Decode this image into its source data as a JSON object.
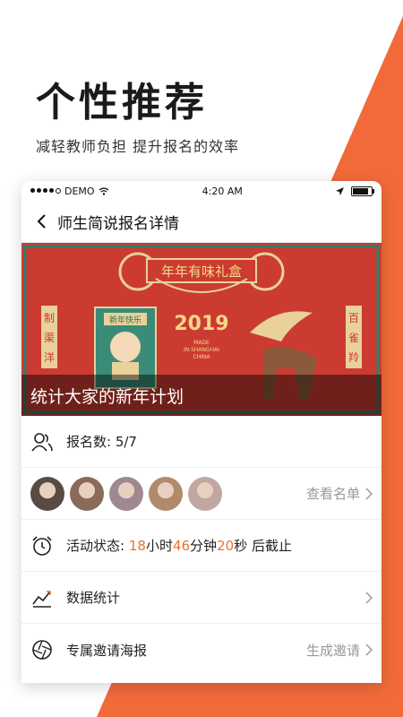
{
  "promo": {
    "headline": "个性推荐",
    "subheadline": "减轻教师负担 提升报名的效率",
    "accent_color": "#f26a3a"
  },
  "status_bar": {
    "carrier": "DEMO",
    "time": "4:20 AM"
  },
  "nav": {
    "title": "师生简说报名详情"
  },
  "banner": {
    "caption": "统计大家的新年计划",
    "art_title": "年年有味礼盒",
    "art_year": "2019",
    "art_made": "MADE",
    "art_in": "IN SHANGHAI",
    "art_china": "CHINA",
    "art_left_chars": [
      "制",
      "渠",
      "洋"
    ],
    "art_right_chars": [
      "百",
      "雀",
      "羚"
    ],
    "art_card": "新年快乐"
  },
  "signup": {
    "label": "报名数: 5/7"
  },
  "participants": {
    "view_list": "查看名单",
    "avatar_colors": [
      "#5a4a44",
      "#8a6a58",
      "#a08890",
      "#b08a6a",
      "#c0a8a0"
    ]
  },
  "activity": {
    "label_prefix": "活动状态:",
    "hours": "18",
    "hours_unit": "小时",
    "minutes": "46",
    "minutes_unit": "分钟",
    "seconds": "20",
    "seconds_unit": "秒",
    "suffix": "后截止"
  },
  "stats": {
    "label": "数据统计"
  },
  "poster": {
    "label": "专属邀请海报",
    "action": "生成邀请"
  }
}
